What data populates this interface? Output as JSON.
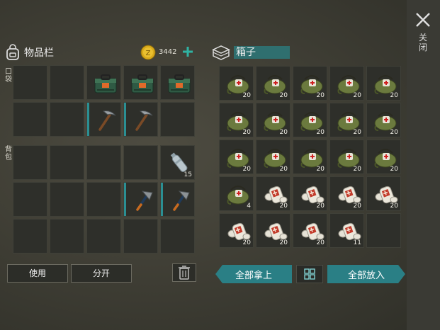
{
  "inventory": {
    "title": "物品栏",
    "coins": "3442",
    "pocket_label": "口袋",
    "backpack_label": "背包",
    "pockets": [
      {
        "item": "",
        "qty": ""
      },
      {
        "item": "",
        "qty": ""
      },
      {
        "item": "med-case",
        "qty": ""
      },
      {
        "item": "med-case",
        "qty": ""
      },
      {
        "item": "med-case",
        "qty": ""
      },
      {
        "item": "",
        "qty": ""
      },
      {
        "item": "",
        "qty": ""
      },
      {
        "item": "pickaxe",
        "qty": ""
      },
      {
        "item": "pickaxe",
        "qty": ""
      },
      {
        "item": "",
        "qty": ""
      }
    ],
    "backpack": [
      {
        "item": "",
        "qty": ""
      },
      {
        "item": "",
        "qty": ""
      },
      {
        "item": "",
        "qty": ""
      },
      {
        "item": "",
        "qty": ""
      },
      {
        "item": "bottle",
        "qty": "15"
      },
      {
        "item": "",
        "qty": ""
      },
      {
        "item": "",
        "qty": ""
      },
      {
        "item": "",
        "qty": ""
      },
      {
        "item": "hatchet",
        "qty": ""
      },
      {
        "item": "hatchet",
        "qty": ""
      },
      {
        "item": "",
        "qty": ""
      },
      {
        "item": "",
        "qty": ""
      },
      {
        "item": "",
        "qty": ""
      },
      {
        "item": "",
        "qty": ""
      },
      {
        "item": "",
        "qty": ""
      }
    ],
    "use_label": "使用",
    "split_label": "分开"
  },
  "box": {
    "title": "箱子",
    "slots": [
      {
        "item": "med-bag",
        "qty": "20"
      },
      {
        "item": "med-bag",
        "qty": "20"
      },
      {
        "item": "med-bag",
        "qty": "20"
      },
      {
        "item": "med-bag",
        "qty": "20"
      },
      {
        "item": "med-bag",
        "qty": "20"
      },
      {
        "item": "med-bag",
        "qty": "20"
      },
      {
        "item": "med-bag",
        "qty": "20"
      },
      {
        "item": "med-bag",
        "qty": "20"
      },
      {
        "item": "med-bag",
        "qty": "20"
      },
      {
        "item": "med-bag",
        "qty": "20"
      },
      {
        "item": "med-bag",
        "qty": "20"
      },
      {
        "item": "med-bag",
        "qty": "20"
      },
      {
        "item": "med-bag",
        "qty": "20"
      },
      {
        "item": "med-bag",
        "qty": "20"
      },
      {
        "item": "med-bag",
        "qty": "20"
      },
      {
        "item": "med-bag",
        "qty": "4"
      },
      {
        "item": "bandage",
        "qty": "20"
      },
      {
        "item": "bandage",
        "qty": "20"
      },
      {
        "item": "bandage",
        "qty": "20"
      },
      {
        "item": "bandage",
        "qty": "20"
      },
      {
        "item": "bandage",
        "qty": "20"
      },
      {
        "item": "bandage",
        "qty": "20"
      },
      {
        "item": "bandage",
        "qty": "20"
      },
      {
        "item": "bandage",
        "qty": "11"
      },
      {
        "item": "",
        "qty": ""
      }
    ],
    "take_all_label": "全部拿上",
    "put_all_label": "全部放入"
  },
  "close_label": "关闭",
  "colors": {
    "accent": "#2a7f85",
    "coin": "#d8a91b",
    "plus": "#2fb3a3"
  }
}
